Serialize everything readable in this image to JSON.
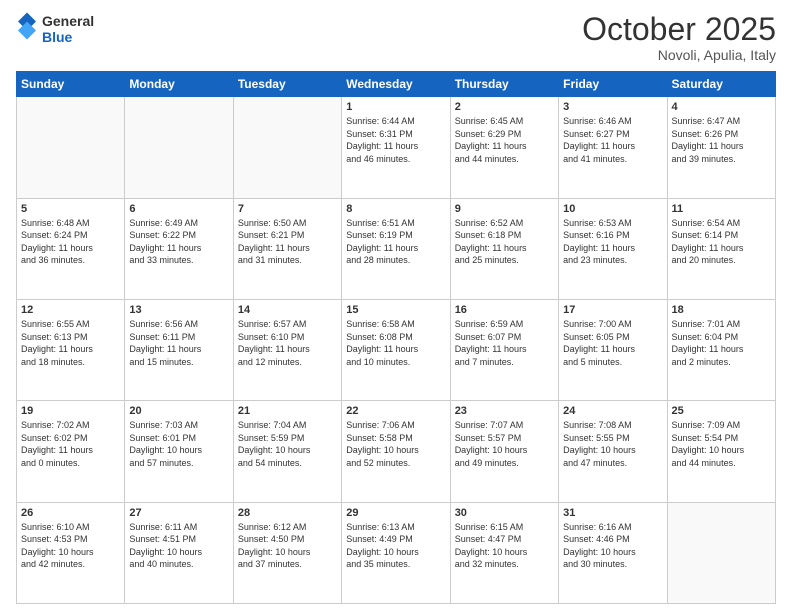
{
  "logo": {
    "general": "General",
    "blue": "Blue"
  },
  "header": {
    "month": "October 2025",
    "location": "Novoli, Apulia, Italy"
  },
  "weekdays": [
    "Sunday",
    "Monday",
    "Tuesday",
    "Wednesday",
    "Thursday",
    "Friday",
    "Saturday"
  ],
  "weeks": [
    [
      {
        "day": "",
        "info": ""
      },
      {
        "day": "",
        "info": ""
      },
      {
        "day": "",
        "info": ""
      },
      {
        "day": "1",
        "info": "Sunrise: 6:44 AM\nSunset: 6:31 PM\nDaylight: 11 hours\nand 46 minutes."
      },
      {
        "day": "2",
        "info": "Sunrise: 6:45 AM\nSunset: 6:29 PM\nDaylight: 11 hours\nand 44 minutes."
      },
      {
        "day": "3",
        "info": "Sunrise: 6:46 AM\nSunset: 6:27 PM\nDaylight: 11 hours\nand 41 minutes."
      },
      {
        "day": "4",
        "info": "Sunrise: 6:47 AM\nSunset: 6:26 PM\nDaylight: 11 hours\nand 39 minutes."
      }
    ],
    [
      {
        "day": "5",
        "info": "Sunrise: 6:48 AM\nSunset: 6:24 PM\nDaylight: 11 hours\nand 36 minutes."
      },
      {
        "day": "6",
        "info": "Sunrise: 6:49 AM\nSunset: 6:22 PM\nDaylight: 11 hours\nand 33 minutes."
      },
      {
        "day": "7",
        "info": "Sunrise: 6:50 AM\nSunset: 6:21 PM\nDaylight: 11 hours\nand 31 minutes."
      },
      {
        "day": "8",
        "info": "Sunrise: 6:51 AM\nSunset: 6:19 PM\nDaylight: 11 hours\nand 28 minutes."
      },
      {
        "day": "9",
        "info": "Sunrise: 6:52 AM\nSunset: 6:18 PM\nDaylight: 11 hours\nand 25 minutes."
      },
      {
        "day": "10",
        "info": "Sunrise: 6:53 AM\nSunset: 6:16 PM\nDaylight: 11 hours\nand 23 minutes."
      },
      {
        "day": "11",
        "info": "Sunrise: 6:54 AM\nSunset: 6:14 PM\nDaylight: 11 hours\nand 20 minutes."
      }
    ],
    [
      {
        "day": "12",
        "info": "Sunrise: 6:55 AM\nSunset: 6:13 PM\nDaylight: 11 hours\nand 18 minutes."
      },
      {
        "day": "13",
        "info": "Sunrise: 6:56 AM\nSunset: 6:11 PM\nDaylight: 11 hours\nand 15 minutes."
      },
      {
        "day": "14",
        "info": "Sunrise: 6:57 AM\nSunset: 6:10 PM\nDaylight: 11 hours\nand 12 minutes."
      },
      {
        "day": "15",
        "info": "Sunrise: 6:58 AM\nSunset: 6:08 PM\nDaylight: 11 hours\nand 10 minutes."
      },
      {
        "day": "16",
        "info": "Sunrise: 6:59 AM\nSunset: 6:07 PM\nDaylight: 11 hours\nand 7 minutes."
      },
      {
        "day": "17",
        "info": "Sunrise: 7:00 AM\nSunset: 6:05 PM\nDaylight: 11 hours\nand 5 minutes."
      },
      {
        "day": "18",
        "info": "Sunrise: 7:01 AM\nSunset: 6:04 PM\nDaylight: 11 hours\nand 2 minutes."
      }
    ],
    [
      {
        "day": "19",
        "info": "Sunrise: 7:02 AM\nSunset: 6:02 PM\nDaylight: 11 hours\nand 0 minutes."
      },
      {
        "day": "20",
        "info": "Sunrise: 7:03 AM\nSunset: 6:01 PM\nDaylight: 10 hours\nand 57 minutes."
      },
      {
        "day": "21",
        "info": "Sunrise: 7:04 AM\nSunset: 5:59 PM\nDaylight: 10 hours\nand 54 minutes."
      },
      {
        "day": "22",
        "info": "Sunrise: 7:06 AM\nSunset: 5:58 PM\nDaylight: 10 hours\nand 52 minutes."
      },
      {
        "day": "23",
        "info": "Sunrise: 7:07 AM\nSunset: 5:57 PM\nDaylight: 10 hours\nand 49 minutes."
      },
      {
        "day": "24",
        "info": "Sunrise: 7:08 AM\nSunset: 5:55 PM\nDaylight: 10 hours\nand 47 minutes."
      },
      {
        "day": "25",
        "info": "Sunrise: 7:09 AM\nSunset: 5:54 PM\nDaylight: 10 hours\nand 44 minutes."
      }
    ],
    [
      {
        "day": "26",
        "info": "Sunrise: 6:10 AM\nSunset: 4:53 PM\nDaylight: 10 hours\nand 42 minutes."
      },
      {
        "day": "27",
        "info": "Sunrise: 6:11 AM\nSunset: 4:51 PM\nDaylight: 10 hours\nand 40 minutes."
      },
      {
        "day": "28",
        "info": "Sunrise: 6:12 AM\nSunset: 4:50 PM\nDaylight: 10 hours\nand 37 minutes."
      },
      {
        "day": "29",
        "info": "Sunrise: 6:13 AM\nSunset: 4:49 PM\nDaylight: 10 hours\nand 35 minutes."
      },
      {
        "day": "30",
        "info": "Sunrise: 6:15 AM\nSunset: 4:47 PM\nDaylight: 10 hours\nand 32 minutes."
      },
      {
        "day": "31",
        "info": "Sunrise: 6:16 AM\nSunset: 4:46 PM\nDaylight: 10 hours\nand 30 minutes."
      },
      {
        "day": "",
        "info": ""
      }
    ]
  ]
}
